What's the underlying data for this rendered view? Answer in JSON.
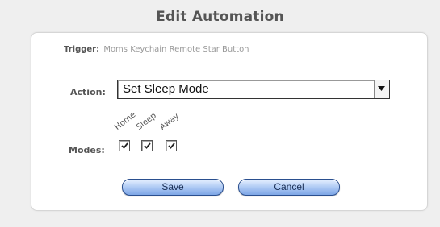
{
  "title": "Edit Automation",
  "trigger": {
    "label": "Trigger:",
    "value": "Moms Keychain Remote Star Button"
  },
  "action": {
    "label": "Action:",
    "selected": "Set Sleep Mode"
  },
  "modes": {
    "label": "Modes:",
    "items": [
      {
        "name": "Home",
        "checked": true
      },
      {
        "name": "Sleep",
        "checked": true
      },
      {
        "name": "Away",
        "checked": true
      }
    ]
  },
  "buttons": {
    "save": "Save",
    "cancel": "Cancel"
  },
  "colors": {
    "button_fill": "#a9c6f3",
    "button_border": "#2a4f8f"
  }
}
